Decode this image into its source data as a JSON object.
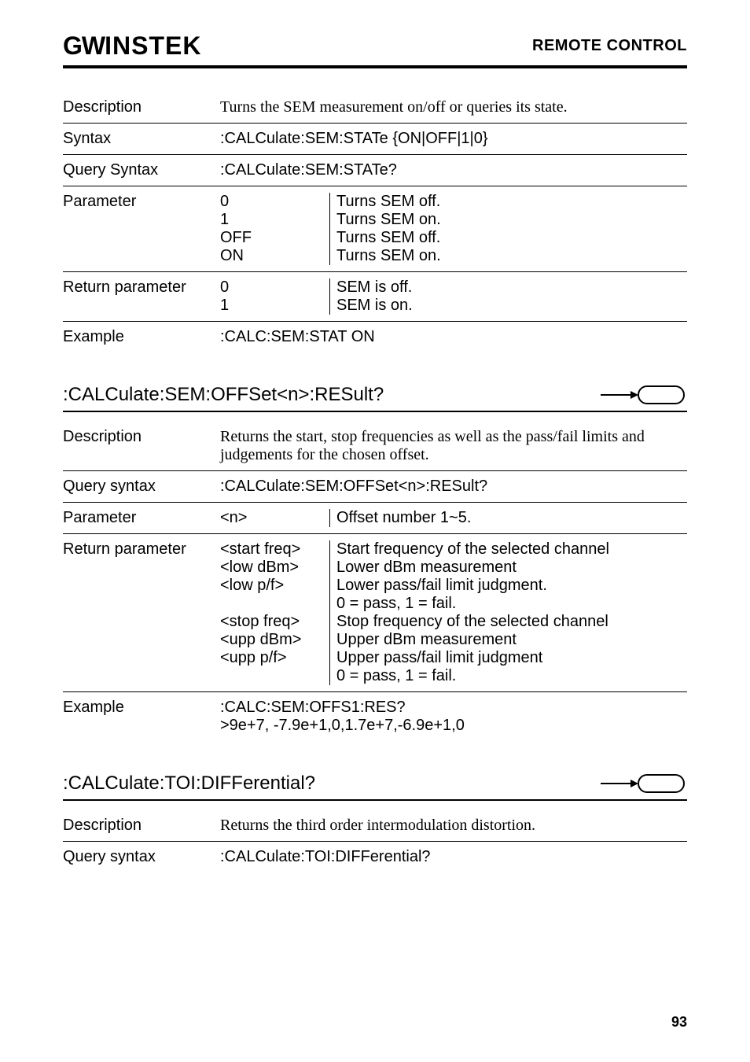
{
  "header": {
    "logo_gw": "GW",
    "logo_rest": "INSTEK",
    "page_title": "REMOTE CONTROL"
  },
  "section1": {
    "description_label": "Description",
    "description_text": "Turns the SEM measurement on/off or queries its state.",
    "syntax_label": "Syntax",
    "syntax_text": ":CALCulate:SEM:STATe {ON|OFF|1|0}",
    "query_syntax_label": "Query Syntax",
    "query_syntax_text": ":CALCulate:SEM:STATe?",
    "parameter_label": "Parameter",
    "param_rows": [
      {
        "c1": "0",
        "c2": "Turns SEM off."
      },
      {
        "c1": "1",
        "c2": "Turns SEM on."
      },
      {
        "c1": "OFF",
        "c2": "Turns SEM off."
      },
      {
        "c1": "ON",
        "c2": "Turns SEM on."
      }
    ],
    "return_label": "Return parameter",
    "return_rows": [
      {
        "c1": "0",
        "c2": "SEM is off."
      },
      {
        "c1": "1",
        "c2": "SEM is on."
      }
    ],
    "example_label": "Example",
    "example_text": ":CALC:SEM:STAT ON"
  },
  "section2": {
    "heading": ":CALCulate:SEM:OFFSet<n>:RESult?",
    "description_label": "Description",
    "description_text": "Returns the start, stop frequencies as well as the pass/fail limits and judgements for the chosen offset.",
    "query_syntax_label": "Query syntax",
    "query_syntax_text": ":CALCulate:SEM:OFFSet<n>:RESult?",
    "parameter_label": "Parameter",
    "param_rows": [
      {
        "c1": "<n>",
        "c2": "Offset number 1~5."
      }
    ],
    "return_label": "Return parameter",
    "return_rows": [
      {
        "c1": "<start freq>",
        "c2": "Start frequency of the selected channel"
      },
      {
        "c1": "<low dBm>",
        "c2": "Lower dBm measurement"
      },
      {
        "c1": "<low p/f>",
        "c2": "Lower pass/fail limit judgment."
      },
      {
        "c1": "",
        "c2": "0 = pass, 1 = fail."
      },
      {
        "c1": "<stop freq>",
        "c2": "Stop frequency of the selected channel"
      },
      {
        "c1": "<upp dBm>",
        "c2": "Upper dBm measurement"
      },
      {
        "c1": "<upp p/f>",
        "c2": "Upper pass/fail limit judgment"
      },
      {
        "c1": "",
        "c2": "0 = pass, 1 = fail."
      }
    ],
    "example_label": "Example",
    "example_line1": ":CALC:SEM:OFFS1:RES?",
    "example_line2": ">9e+7, -7.9e+1,0,1.7e+7,-6.9e+1,0"
  },
  "section3": {
    "heading": ":CALCulate:TOI:DIFFerential?",
    "description_label": "Description",
    "description_text": "Returns the third order intermodulation distortion.",
    "query_syntax_label": "Query syntax",
    "query_syntax_text": ":CALCulate:TOI:DIFFerential?"
  },
  "page_number": "93"
}
